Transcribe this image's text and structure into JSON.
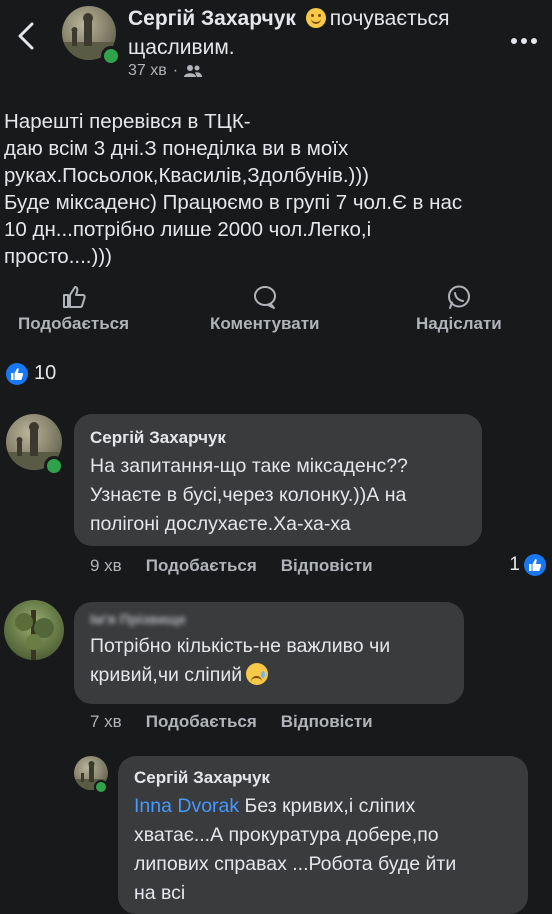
{
  "header": {
    "author": "Сергій Захарчук",
    "feeling_prefix": "почувається",
    "feeling_suffix": "щасливим.",
    "time": "37 хв",
    "separator": "·",
    "more_icon": "ellipsis-icon"
  },
  "post": {
    "text": "Нарешті перевівся в ТЦК-\nдаю всім 3 дні.З понеділка ви в моїх\nруках.Посьолок,Квасилів,Здолбунів.)))\nБуде міксаденс) Працюємо в групі 7 чол.Є в нас\n10 дн...потрібно лише 2000 чол.Легко,і\nпросто....)))"
  },
  "actions": {
    "like": "Подобається",
    "comment": "Коментувати",
    "share": "Надіслати"
  },
  "reactions": {
    "count": "10"
  },
  "comments": [
    {
      "name": "Сергій Захарчук",
      "text": "На запитання-що таке міксаденс??\nУзнаєте в бусі,через колонку.))А на\nполігоні дослухаєте.Ха-ха-ха",
      "time": "9 хв",
      "like": "Подобається",
      "reply": "Відповісти",
      "likes": "1"
    },
    {
      "name": "Ім'я Прізвище",
      "text": "Потрібно кількість-не важливо чи\nкривий,чи сліпий",
      "time": "7 хв",
      "like": "Подобається",
      "reply": "Відповісти"
    },
    {
      "name": "Сергій Захарчук",
      "mention": "Inna Dvorak",
      "text": " Без кривих,і сліпих\nхватає...А прокуратура добере,по\nлипових справах ...Робота буде йти\nна всі"
    }
  ],
  "colors": {
    "background": "#18191a",
    "bubble": "#3a3b3c",
    "accent": "#1877f2",
    "online": "#31a24c",
    "mention": "#4599ff"
  }
}
